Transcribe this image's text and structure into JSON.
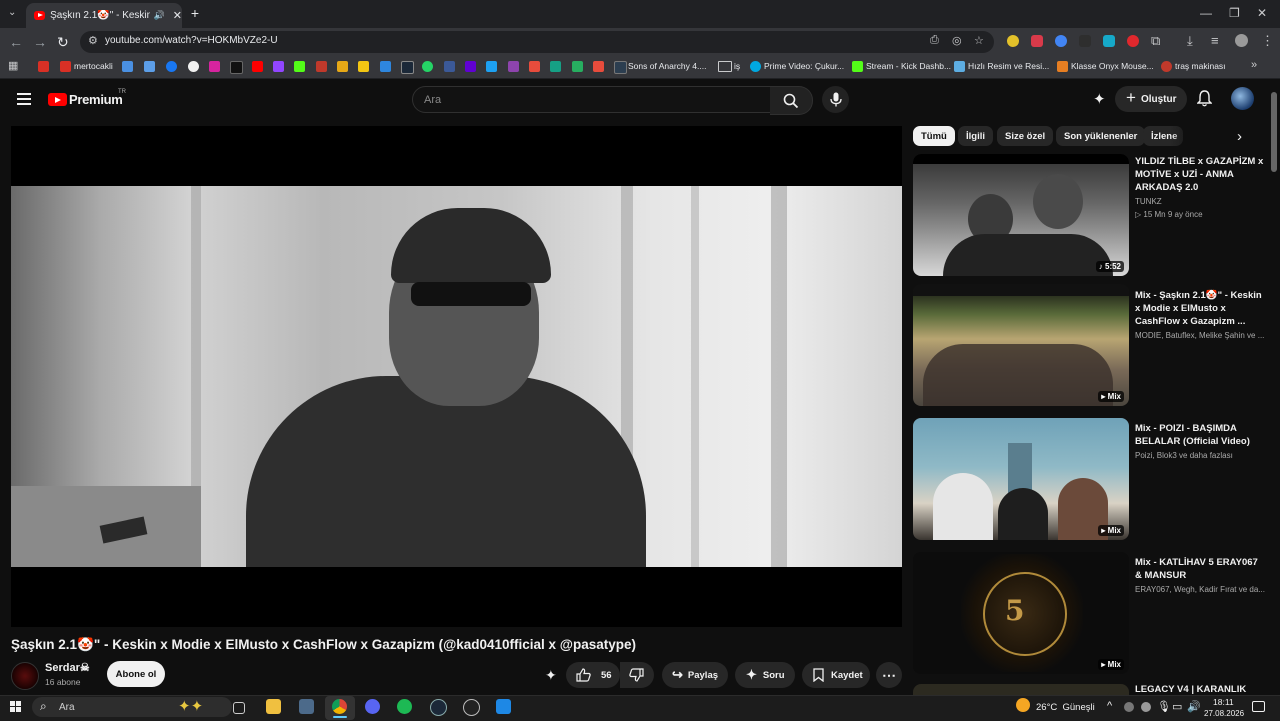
{
  "browser": {
    "tab_title": "Şaşkın 2.1🤡\" - Keskin x Mo",
    "url": "youtube.com/watch?v=HOKMbVZe2-U",
    "bookmarks": [
      "mertocakli",
      "Sons of Anarchy 4....",
      "iş",
      "Prime Video: Çukur...",
      "Stream - Kick Dashb...",
      "Hızlı Resim ve Resi...",
      "Klasse Onyx Mouse...",
      "traş makinası"
    ]
  },
  "header": {
    "brand": "Premium",
    "country": "TR",
    "search_placeholder": "Ara",
    "create_label": "Oluştur"
  },
  "video": {
    "title": "Şaşkın 2.1🤡\" - Keskin x Modie x ElMusto x CashFlow x Gazapizm (@kad0410fficial x @pasatype)",
    "channel": "Serdar☠",
    "subscribers": "16 abone",
    "subscribe_label": "Abone ol",
    "likes": "56",
    "share_label": "Paylaş",
    "ask_label": "Soru",
    "save_label": "Kaydet"
  },
  "chips": [
    "Tümü",
    "İlgili",
    "Size özel",
    "Son yüklenenler",
    "İzlene"
  ],
  "recommendations": [
    {
      "title": "YILDIZ TİLBE x GAZAPİZM x MOTİVE x UZİ - ANMA ARKADAŞ 2.0",
      "channel": "TUNKZ",
      "meta": "▷ 15 Mn   9 ay önce",
      "badge": "♪ 5:52"
    },
    {
      "title": "Mix - Şaşkın 2.1🤡\" - Keskin x Modie x ElMusto x CashFlow x Gazapizm ...",
      "channel": "MODIE, Batuflex, Melike Şahin ve ...",
      "meta": "",
      "badge": "▸ Mix"
    },
    {
      "title": "Mix - POIZI - BAŞIMDA BELALAR (Official Video)",
      "channel": "Poizi, Blok3 ve daha fazlası",
      "meta": "",
      "badge": "▸ Mix"
    },
    {
      "title": "Mix - KATLİHAV 5 ERAY067 & MANSUR",
      "channel": "ERAY067, Wegh, Kadir Fırat ve da...",
      "meta": "",
      "badge": "▸ Mix"
    },
    {
      "title": "LEGACY V4 | KARANLIK",
      "channel": "",
      "meta": "",
      "badge": ""
    }
  ],
  "taskbar": {
    "search_label": "Ara",
    "weather": "26°C  Güneşli",
    "time": "18:11",
    "date": "27.08.2026"
  }
}
